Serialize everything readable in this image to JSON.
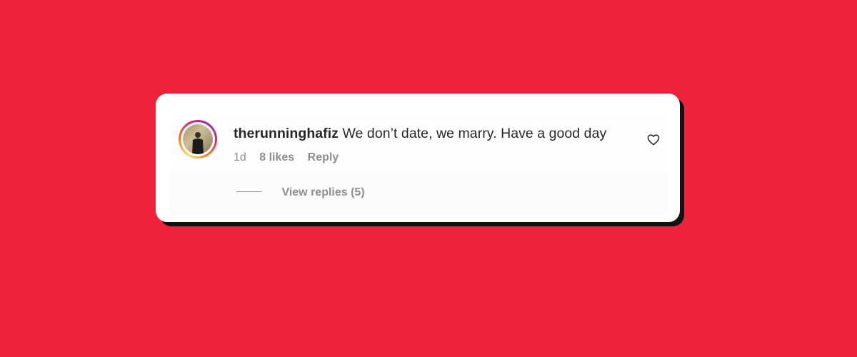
{
  "comment": {
    "username": "therunninghafiz",
    "text": "We don’t date, we marry. Have a good day",
    "time_ago": "1d",
    "likes": "8 likes",
    "reply_label": "Reply",
    "view_replies": "View replies (5)",
    "like_icon": "heart-outline-icon"
  },
  "colors": {
    "background": "#ef223b",
    "card": "#ffffff",
    "text_primary": "#262626",
    "text_secondary": "#8e8e8e"
  }
}
